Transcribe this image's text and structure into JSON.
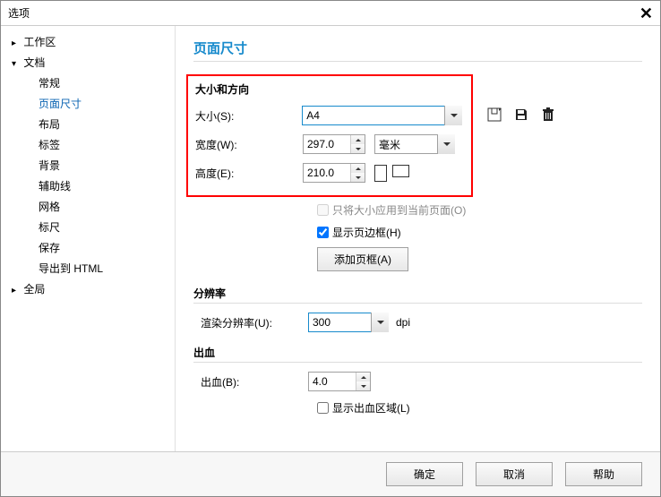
{
  "title": "选项",
  "tree": {
    "workspace": "工作区",
    "document": "文档",
    "doc_children": {
      "general": "常规",
      "page_size": "页面尺寸",
      "layout": "布局",
      "label": "标签",
      "background": "背景",
      "guidelines": "辅助线",
      "grid": "网格",
      "ruler": "标尺",
      "save": "保存",
      "export_html": "导出到 HTML"
    },
    "global": "全局"
  },
  "page_title": "页面尺寸",
  "sect_size_orient": "大小和方向",
  "labels": {
    "size": "大小(S):",
    "width": "宽度(W):",
    "height": "高度(E):",
    "unit": "毫米",
    "render_res": "渲染分辨率(U):",
    "dpi": "dpi",
    "bleed": "出血(B):"
  },
  "values": {
    "size": "A4",
    "width": "297.0",
    "height": "210.0",
    "render_res": "300",
    "bleed": "4.0"
  },
  "checkboxes": {
    "apply_current_only": "只将大小应用到当前页面(O)",
    "show_page_frame": "显示页边框(H)",
    "show_bleed_area": "显示出血区域(L)"
  },
  "buttons": {
    "add_frame": "添加页框(A)",
    "ok": "确定",
    "cancel": "取消",
    "help": "帮助"
  },
  "groups": {
    "resolution": "分辨率",
    "bleed": "出血"
  }
}
